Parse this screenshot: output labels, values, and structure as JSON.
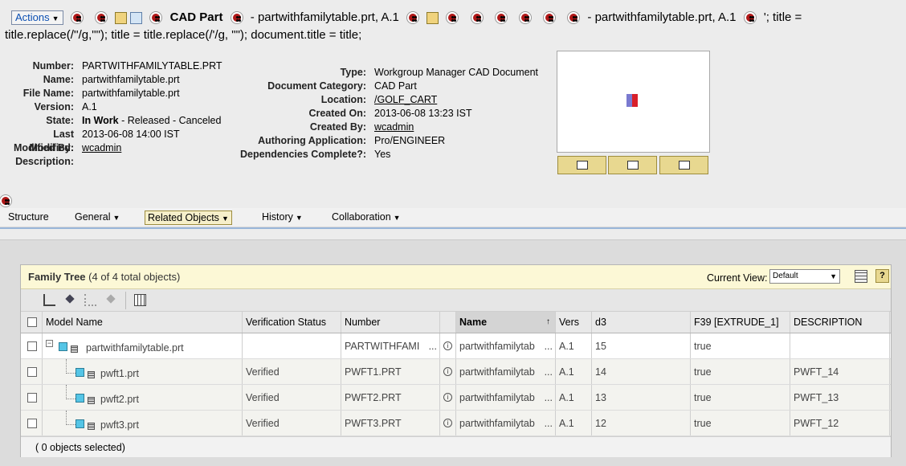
{
  "header": {
    "actions_label": "Actions",
    "type_label": "CAD Part",
    "title_part1": "- partwithfamilytable.prt, A.1",
    "title_part2": "- partwithfamilytable.prt, A.1",
    "title_trail": "'; title =",
    "title_line2": "title.replace(/''/g,\"\"); title = title.replace(/'/g, \"\"); document.title = title;"
  },
  "attributes_left": [
    {
      "key": "Number:",
      "value": "PARTWITHFAMILYTABLE.PRT"
    },
    {
      "key": "Name:",
      "value": "partwithfamilytable.prt"
    },
    {
      "key": "File Name:",
      "value": "partwithfamilytable.prt"
    },
    {
      "key": "Version:",
      "value": "A.1"
    },
    {
      "key": "State:",
      "value_bold": "In Work",
      "value_rest": " - Released - Canceled"
    },
    {
      "key": "Last Modified:",
      "value": "2013-06-08 14:00 IST"
    },
    {
      "key": "Modified By:",
      "value": "wcadmin"
    },
    {
      "key": "Description:",
      "value": ""
    }
  ],
  "attributes_mid": [
    {
      "key": "Type:",
      "value": "Workgroup Manager CAD Document"
    },
    {
      "key": "Document Category:",
      "value": "CAD Part"
    },
    {
      "key": "Location:",
      "value": "/GOLF_CART"
    },
    {
      "key": "Created On:",
      "value": "2013-06-08 13:23 IST"
    },
    {
      "key": "Created By:",
      "value": "wcadmin"
    },
    {
      "key": "Authoring Application:",
      "value": "Pro/ENGINEER"
    },
    {
      "key": "Dependencies Complete?:",
      "value": "Yes"
    }
  ],
  "nav": {
    "structure": "Structure",
    "general": "General",
    "related_objects": "Related Objects",
    "history": "History",
    "collaboration": "Collaboration"
  },
  "panel": {
    "title": "Family Tree",
    "count": "(4 of 4 total objects)",
    "current_view_label": "Current View:",
    "current_view_value": "Default",
    "help_label": "?",
    "status_text": "( 0 objects selected)"
  },
  "table": {
    "columns": [
      "Model Name",
      "Verification Status",
      "Number",
      "Name",
      "Vers",
      "d3",
      "F39 [EXTRUDE_1]",
      "DESCRIPTION"
    ],
    "rows": [
      {
        "model": "partwithfamilytable.prt",
        "verification": "",
        "number": "PARTWITHFAMI",
        "name": "partwithfamilytab",
        "version": "A.1",
        "d3": "15",
        "f39": "true",
        "description": ""
      },
      {
        "model": "pwft1.prt",
        "verification": "Verified",
        "number": "PWFT1.PRT",
        "name": "partwithfamilytab",
        "version": "A.1",
        "d3": "14",
        "f39": "true",
        "description": "PWFT_14"
      },
      {
        "model": "pwft2.prt",
        "verification": "Verified",
        "number": "PWFT2.PRT",
        "name": "partwithfamilytab",
        "version": "A.1",
        "d3": "13",
        "f39": "true",
        "description": "PWFT_13"
      },
      {
        "model": "pwft3.prt",
        "verification": "Verified",
        "number": "PWFT3.PRT",
        "name": "partwithfamilytab",
        "version": "A.1",
        "d3": "12",
        "f39": "true",
        "description": "PWFT_12"
      }
    ]
  },
  "colors": {
    "panel_header_bg": "#fcf8d6",
    "accent_gold": "#e8d890",
    "link_blue": "#0b4fb3"
  }
}
